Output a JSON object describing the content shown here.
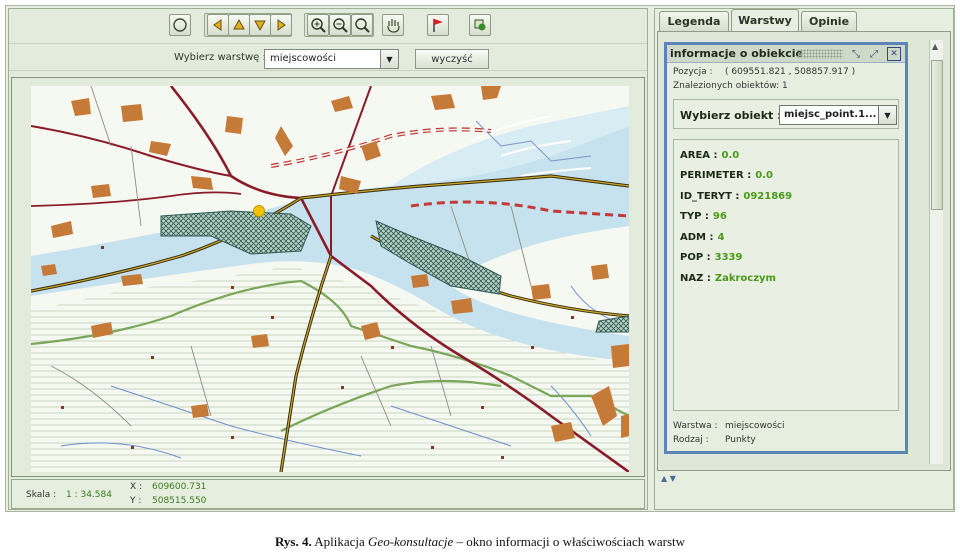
{
  "toolbar": {
    "icons": [
      "circle-icon",
      "arrow-left-icon",
      "arrow-up-icon",
      "arrow-down-icon",
      "arrow-right-icon",
      "zoom-in-icon",
      "zoom-out-icon",
      "zoom-extent-icon",
      "pan-icon",
      "flag-icon",
      "info-icon"
    ]
  },
  "layer_row": {
    "label": "Wybierz warstwę :",
    "selected_layer": "miejscowości",
    "clear_button": "wyczyść"
  },
  "status": {
    "scale_label": "Skala :",
    "scale_value": "1 : 34.584",
    "x_label": "X :",
    "x_value": "609600.731",
    "y_label": "Y :",
    "y_value": "508515.550"
  },
  "tabs": [
    {
      "label": "Legenda",
      "active": false
    },
    {
      "label": "Warstwy",
      "active": true
    },
    {
      "label": "Opinie",
      "active": false
    }
  ],
  "info_window": {
    "title": "informacje o obiekcie",
    "position_label": "Pozycja :",
    "position_value": "( 609551.821 , 508857.917 )",
    "found_label": "Znalezionych obiektów: 1",
    "select_label": "Wybierz obiekt :",
    "selected_object": "miejsc_point.1...",
    "attributes": [
      {
        "key": "AREA :",
        "value": "0.0"
      },
      {
        "key": "PERIMETER :",
        "value": "0.0"
      },
      {
        "key": "ID_TERYT :",
        "value": "0921869"
      },
      {
        "key": "TYP :",
        "value": "96"
      },
      {
        "key": "ADM :",
        "value": "4"
      },
      {
        "key": "POP :",
        "value": "3339"
      },
      {
        "key": "NAZ :",
        "value": "Zakroczym"
      }
    ],
    "layer_label": "Warstwa :",
    "layer_value": "miejscowości",
    "type_label": "Rodzaj :",
    "type_value": "Punkty"
  },
  "caption": {
    "prefix": "Rys. 4.",
    "text_before": " Aplikacja ",
    "app_name": "Geo-konsultacje",
    "text_after": " – okno informacji o właściwościach warstw"
  },
  "colors": {
    "river": "#c7e2ef",
    "road_major": "#8a1c2a",
    "road_secondary": "#6a4a10",
    "settlement": "#c67a38",
    "forest_boundary": "#7aa75a",
    "hatched_area": "#2f5a55",
    "selected_point": "#f2c200",
    "value_green": "#4a9a1a",
    "window_border": "#5d84b8"
  }
}
